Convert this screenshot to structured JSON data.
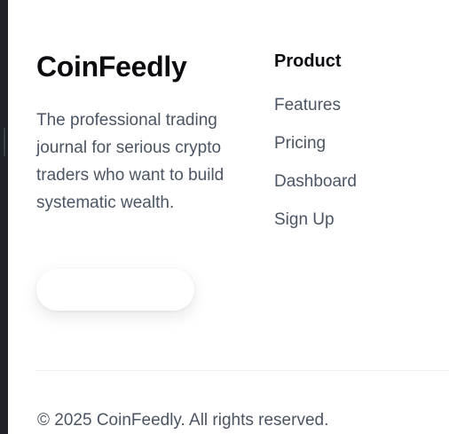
{
  "brand": {
    "name": "CoinFeedly",
    "description": "The professional trading journal for serious crypto traders who want to build systematic wealth.",
    "cta_label": ""
  },
  "product": {
    "heading": "Product",
    "links": [
      {
        "label": "Features"
      },
      {
        "label": "Pricing"
      },
      {
        "label": "Dashboard"
      },
      {
        "label": "Sign Up"
      }
    ]
  },
  "footer": {
    "copyright": "© 2025 CoinFeedly. All rights reserved."
  },
  "colors": {
    "heading": "#0b0b0f",
    "body_text": "#4b5563",
    "background": "#ffffff",
    "edge": "#1f2229"
  }
}
